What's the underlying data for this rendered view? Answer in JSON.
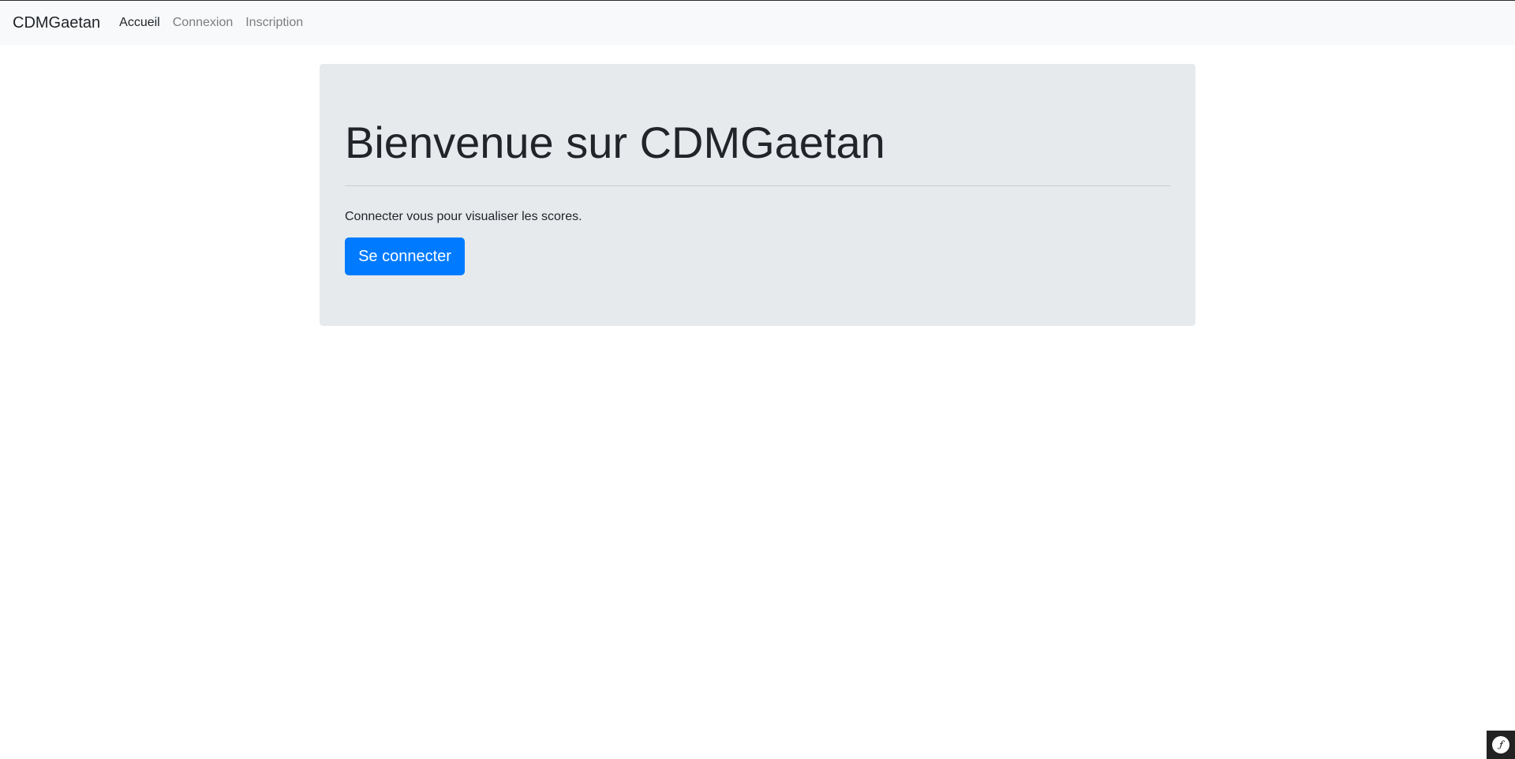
{
  "navbar": {
    "brand": "CDMGaetan",
    "links": [
      {
        "label": "Accueil",
        "active": true
      },
      {
        "label": "Connexion",
        "active": false
      },
      {
        "label": "Inscription",
        "active": false
      }
    ]
  },
  "jumbotron": {
    "title": "Bienvenue sur CDMGaetan",
    "text": "Connecter vous pour visualiser les scores.",
    "button_label": "Se connecter"
  },
  "debug_toolbar": {
    "icon": "symfony-logo-icon"
  },
  "colors": {
    "navbar_bg": "#f8f9fa",
    "jumbotron_bg": "#e7eaed",
    "primary": "#007bff",
    "text": "#212529",
    "muted_link": "#7d7d7d",
    "toolbar_bg": "#222222"
  }
}
